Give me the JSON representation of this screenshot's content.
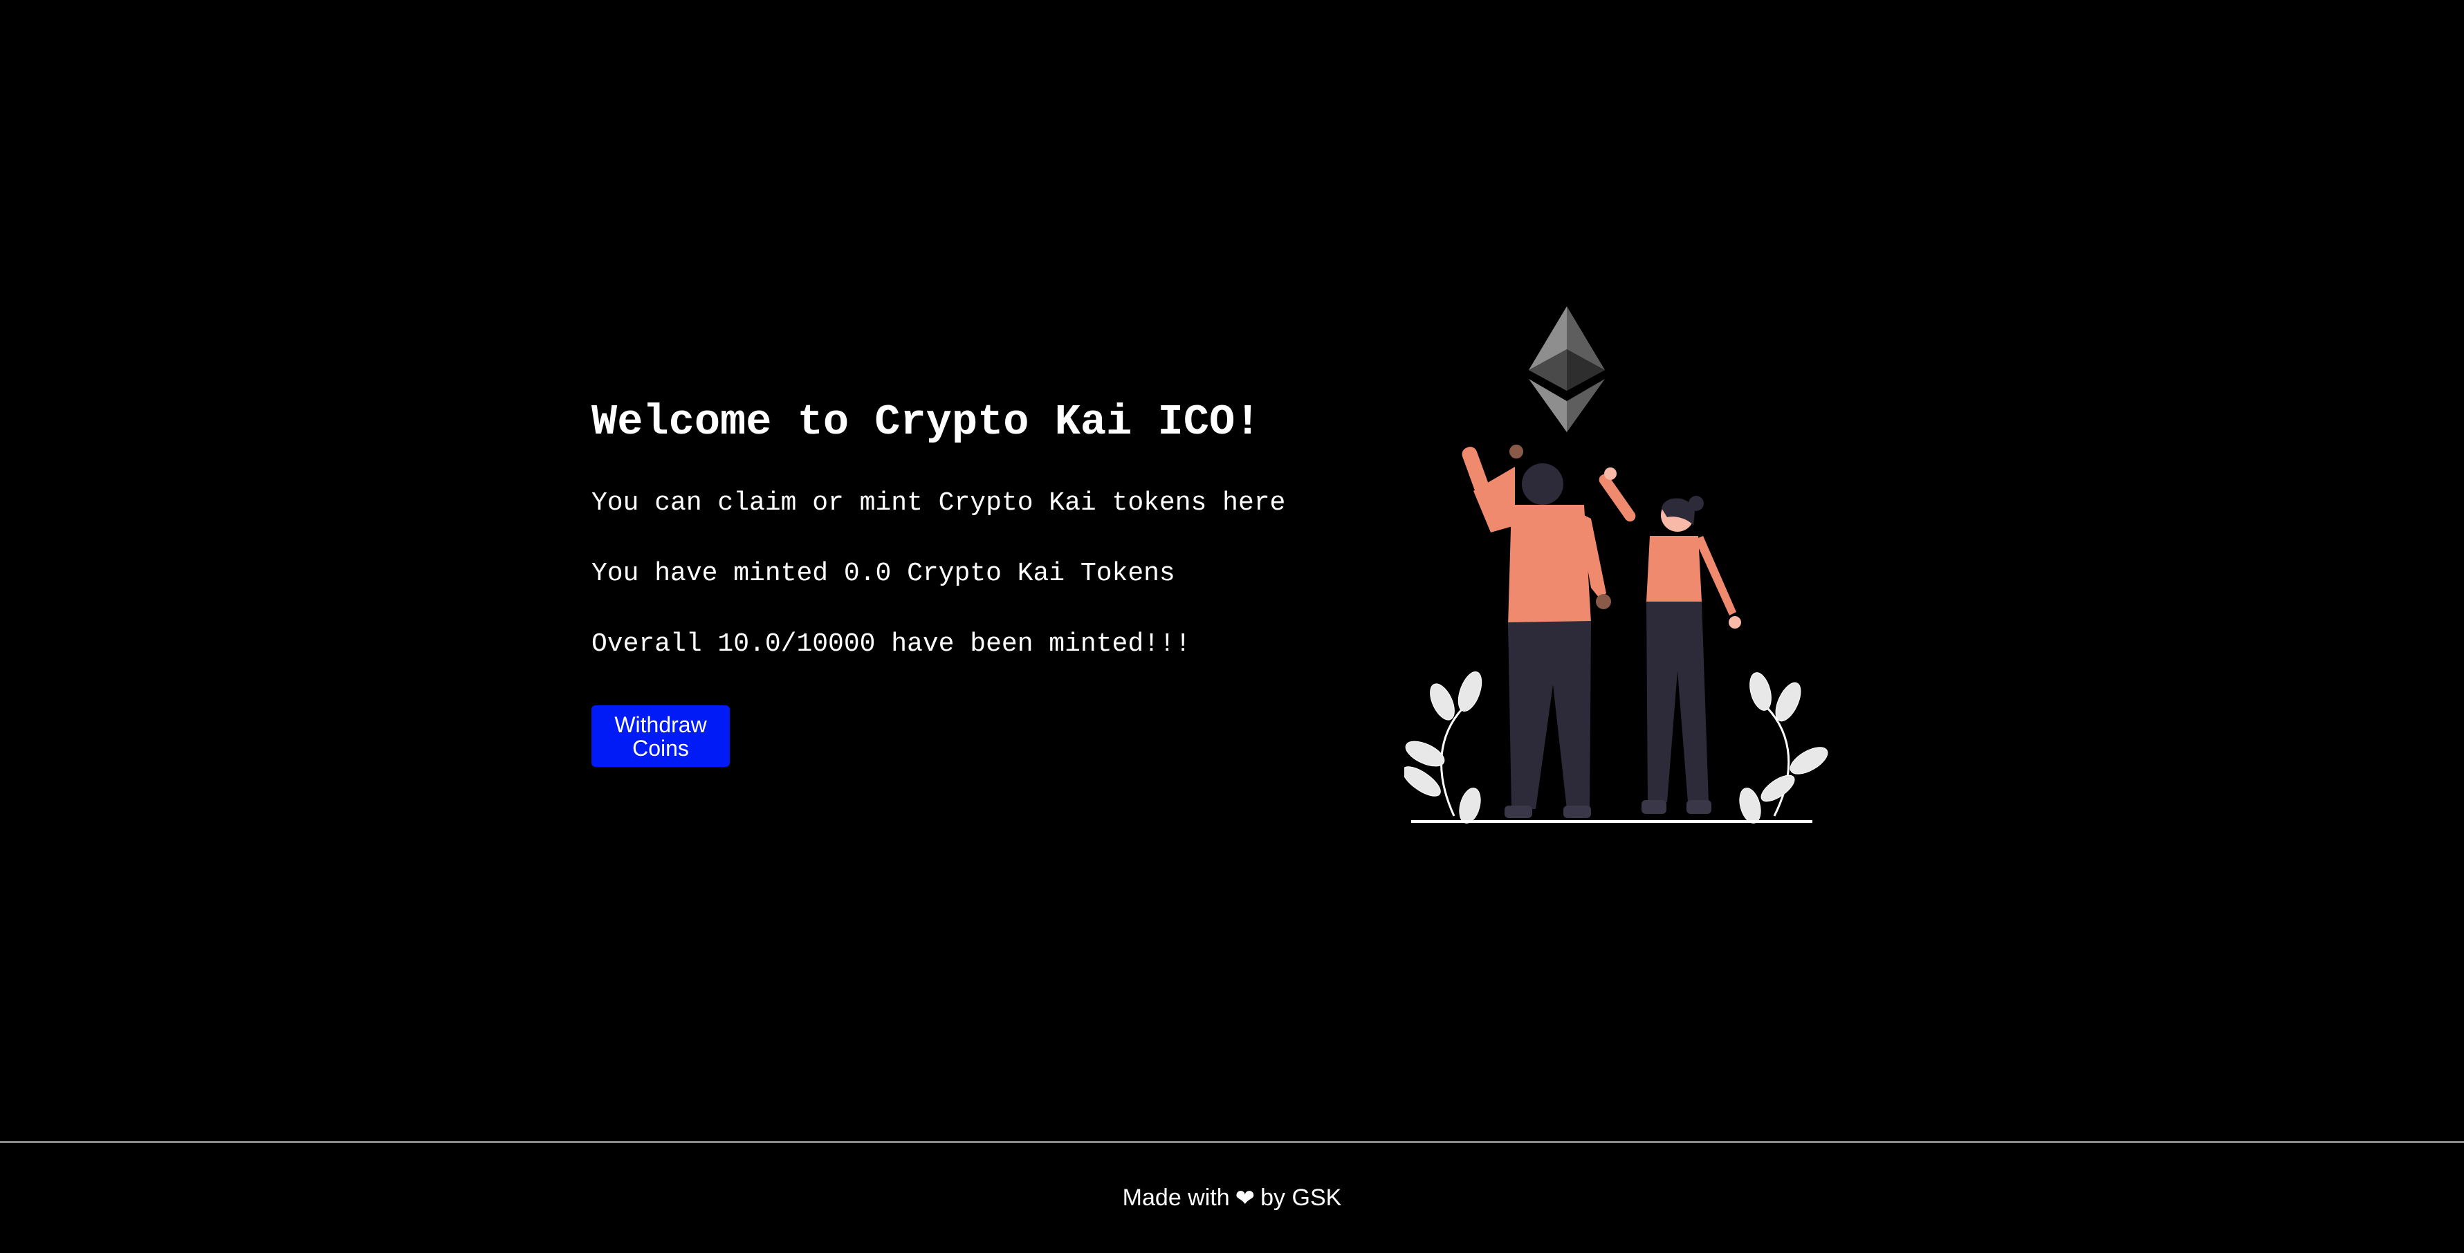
{
  "main": {
    "title": "Welcome to Crypto Kai ICO!",
    "description_lines": [
      "You can claim or mint Crypto Kai tokens here",
      "You have minted 0.0 Crypto Kai Tokens",
      "Overall 10.0/10000 have been minted!!!"
    ],
    "withdraw_button_label": "Withdraw Coins",
    "illustration_icon": "ethereum-celebration-illustration"
  },
  "footer": {
    "made_with": "Made with",
    "heart_symbol": "❤",
    "by_author": "by GSK",
    "heart_icon": "heart-icon"
  },
  "colors": {
    "background": "#000000",
    "text": "#ffffff",
    "button": "#001bf5",
    "figure_skin_shirt": "#f08a6e",
    "figure_pants": "#2d2b3a",
    "divider": "#8a8a8a"
  }
}
